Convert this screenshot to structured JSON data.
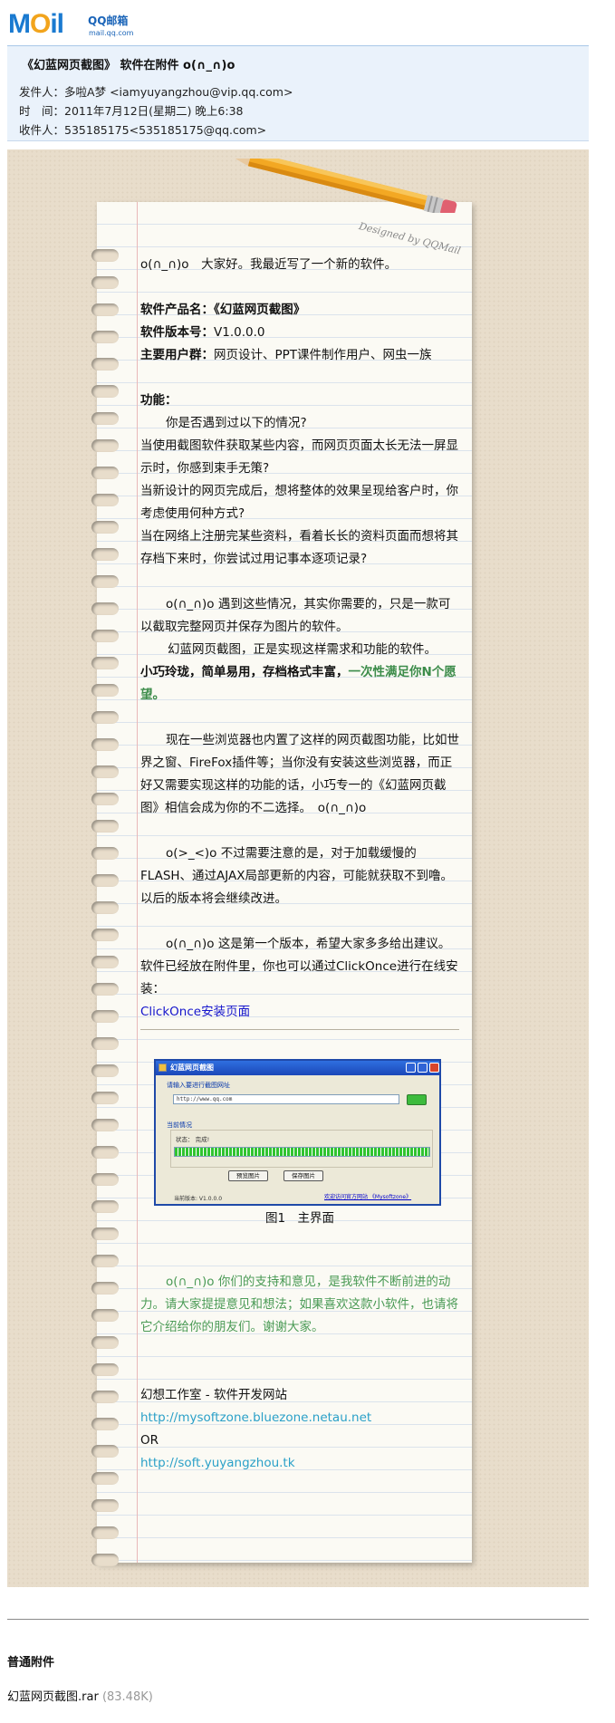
{
  "logo": {
    "brand": "MOil",
    "service": "QQ邮箱",
    "url": "mail.qq.com"
  },
  "email": {
    "subject": "《幻蓝网页截图》 软件在附件 o(∩_∩)o",
    "from_label": "发件人：",
    "from_name": "多啦A梦",
    "from_address": "<iamyuyangzhou@vip.qq.com>",
    "time_label": "时　间：",
    "time_value": "2011年7月12日(星期二) 晚上6:38",
    "to_label": "收件人：",
    "to_value": "535185175<535185175@qq.com>"
  },
  "letter": {
    "signature_mark": "Designed by QQMail",
    "greeting": "o(∩_∩)o　大家好。我最近写了一个新的软件。",
    "product_label": "软件产品名：",
    "product_value": "《幻蓝网页截图》",
    "version_label": "软件版本号：",
    "version_value": "V1.0.0.0",
    "users_label": "主要用户群：",
    "users_value": "网页设计、PPT课件制作用户、网虫一族",
    "features_label": "功能：",
    "q_intro": "你是否遇到过以下的情况?",
    "q1": "当使用截图软件获取某些内容，而网页页面太长无法一屏显示时，你感到束手无策?",
    "q2": "当新设计的网页完成后，想将整体的效果呈现给客户时，你考虑使用何种方式?",
    "q3": "当在网络上注册完某些资料，看着长长的资料页面而想将其存档下来时，你尝试过用记事本逐项记录?",
    "p1": "o(∩_∩)o 遇到这些情况，其实你需要的，只是一款可以截取完整网页并保存为图片的软件。",
    "p2": "幻蓝网页截图，正是实现这样需求和功能的软件。",
    "p3_bold": "小巧玲珑，简单易用，存档格式丰富，",
    "p3_green": "一次性满足你N个愿望。",
    "p4": "现在一些浏览器也内置了这样的网页截图功能，比如世界之窗、FireFox插件等；当你没有安装这些浏览器，而正好又需要实现这样的功能的话，小巧专一的《幻蓝网页截图》相信会成为你的不二选择。　o(∩_∩)o",
    "p5": "o(>_<)o 不过需要注意的是，对于加载缓慢的FLASH、通过AJAX局部更新的内容，可能就获取不到噜。以后的版本将会继续改进。",
    "p6": "o(∩_∩)o 这是第一个版本，希望大家多多给出建议。软件已经放在附件里，你也可以通过ClickOnce进行在线安装：",
    "clickonce_link": "ClickOnce安装页面",
    "caption": "图1　主界面",
    "p7": "o(∩_∩)o 你们的支持和意见，是我软件不断前进的动力。请大家提提意见和想法；如果喜欢这款小软件，也请将它介绍给你的朋友们。谢谢大家。",
    "studio": "幻想工作室 - 软件开发网站",
    "link1": "http://mysoftzone.bluezone.netau.net",
    "or": "OR",
    "link2": "http://soft.yuyangzhou.tk"
  },
  "screenshot": {
    "title": "幻蓝网页截图",
    "url_prompt": "请输入要进行截图网址",
    "url_value": "http://www.qq.com",
    "status_group": "当前情况",
    "status_text": "状态： 完成!",
    "progress": 1.0,
    "preview_button": "预览图片",
    "save_button": "保存图片",
    "version": "当前版本: V1.0.0.0",
    "site_link": "欢迎访问官方网站 《Mysoftzone》"
  },
  "attachments": {
    "title": "普通附件",
    "file_name": "幻蓝网页截图.rar",
    "file_size": "(83.48K)"
  },
  "colors": {
    "header_bg": "#eaf2fb",
    "stage_bg": "#e8ddcb",
    "link_blue": "#1515cc",
    "link_cyan": "#2aa0c8",
    "accent_green": "#3c8c4a"
  }
}
